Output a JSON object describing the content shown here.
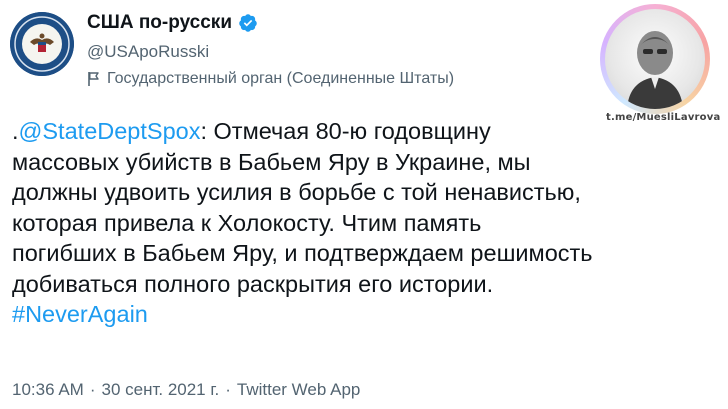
{
  "author": {
    "display_name": "США по-русски",
    "handle": "@USApoRusski",
    "label": "Государственный орган (Соединенные Штаты)",
    "avatar_icon": "us-state-department-seal-icon",
    "verified_icon": "verified-badge-icon"
  },
  "watermark": {
    "caption": "t.me/MuesliLavrova",
    "image_icon": "portrait-sticker-icon"
  },
  "tweet": {
    "prefix": ".",
    "mention": "@StateDeptSpox",
    "line1_rest": ": Отмечая 80-ю годовщину",
    "line2": "массовых убийств в Бабьем Яру в Украине, мы",
    "line3": "должны удвоить усилия в борьбе с той ненавистью,",
    "line4": "которая привела к Холокосту. Чтим память",
    "line5": "погибших в Бабьем Яру, и подтверждаем решимость",
    "line6": "добиваться полного раскрытия его истории.",
    "hashtag": "#NeverAgain"
  },
  "meta": {
    "time": "10:36 AM",
    "sep1": "·",
    "date": "30 сент. 2021 г.",
    "sep2": "·",
    "source": "Twitter Web App"
  },
  "colors": {
    "link": "#1d9bf0",
    "secondary_text": "#536471",
    "primary_text": "#0f1419",
    "verified": "#1d9bf0"
  }
}
